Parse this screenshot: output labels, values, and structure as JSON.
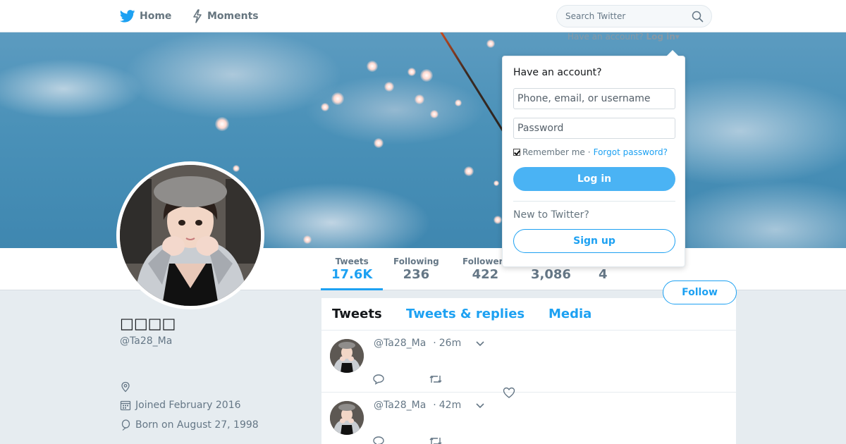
{
  "nav": {
    "home_label": "Home",
    "moments_label": "Moments",
    "home_icon": "twitter-bird-icon",
    "moments_icon": "lightning-icon"
  },
  "search": {
    "placeholder": "Search Twitter",
    "icon": "search-icon"
  },
  "login_bar": {
    "prompt": "Have an account?",
    "link": "Log in"
  },
  "login_dropdown": {
    "title": "Have an account?",
    "username_placeholder": "Phone, email, or username",
    "password_placeholder": "Password",
    "remember_label": "Remember me",
    "separator": "·",
    "forgot_label": "Forgot password?",
    "login_button": "Log in",
    "new_prompt": "New to Twitter?",
    "signup_button": "Sign up"
  },
  "profile": {
    "display_name": "□□□□",
    "screen_name": "@Ta28_Ma",
    "joined": "Joined February 2016",
    "born": "Born on August 27, 1998"
  },
  "stats": [
    {
      "label": "Tweets",
      "value": "17.6K"
    },
    {
      "label": "Following",
      "value": "236"
    },
    {
      "label": "Followers",
      "value": "422"
    },
    {
      "label": "",
      "value": "3,086"
    },
    {
      "label": "",
      "value": "4"
    }
  ],
  "follow_button": "Follow",
  "timeline": {
    "tabs": [
      "Tweets",
      "Tweets & replies",
      "Media"
    ],
    "tweets": [
      {
        "handle": "@Ta28_Ma",
        "time": "26m"
      },
      {
        "handle": "@Ta28_Ma",
        "time": "42m"
      }
    ]
  },
  "colors": {
    "accent": "#1da1f2",
    "login_button": "#4ab3f4",
    "page_bg": "#e6ecf0",
    "muted_text": "#657786"
  }
}
